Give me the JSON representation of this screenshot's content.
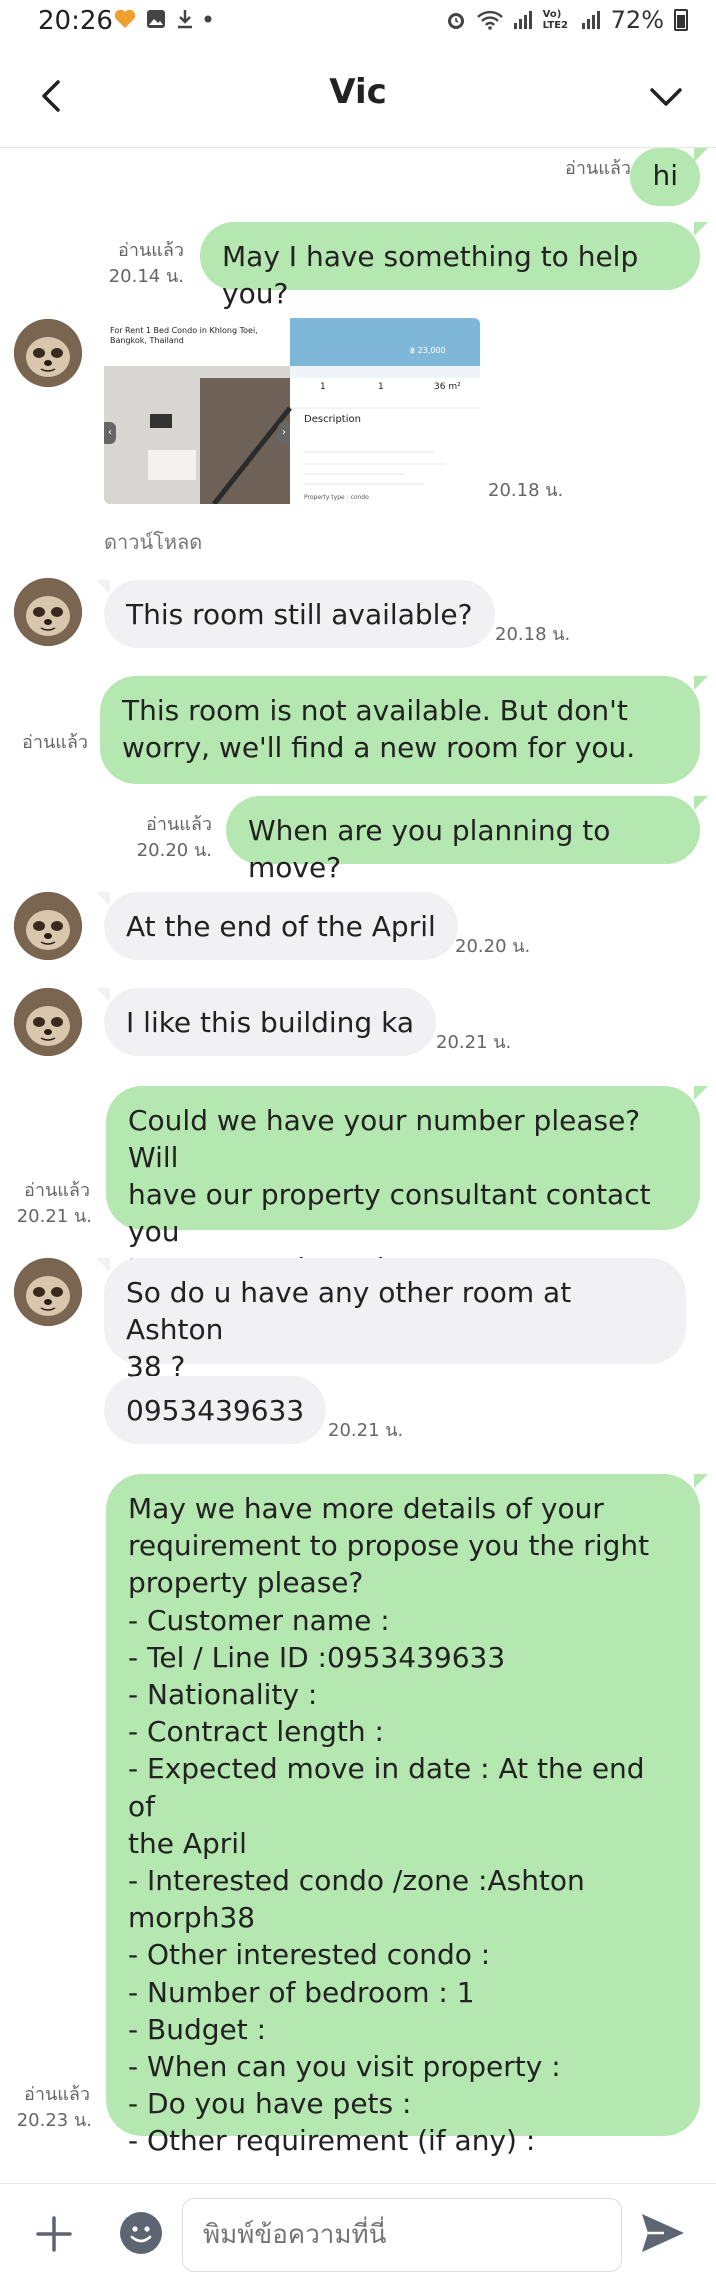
{
  "status_bar": {
    "time": "20:26",
    "carrier_label": "Vo) LTE2",
    "battery": "72%"
  },
  "header": {
    "title": "Vic"
  },
  "messages": {
    "m1": {
      "text": "hi",
      "receipt": "อ่านแล้ว"
    },
    "m2": {
      "text": "May I have something to help you?",
      "receipt": "อ่านแล้ว",
      "time": "20.14 น."
    },
    "m3": {
      "card_title": "For Rent 1 Bed Condo in Khlong Toei, Bangkok, Thailand",
      "card_price": "฿ 23,000",
      "card_beds": "1",
      "card_baths": "1",
      "card_area": "36 m²",
      "card_desc_heading": "Description",
      "card_prop_type": "Property type : condo",
      "time": "20.18 น.",
      "download": "ดาวน์โหลด"
    },
    "m4": {
      "text": "This room still available?",
      "time": "20.18 น."
    },
    "m5": {
      "text": "This room is not available.  But don't\nworry, we'll find a new room for you.",
      "receipt": "อ่านแล้ว"
    },
    "m6": {
      "text": "When are you planning to move?",
      "receipt": "อ่านแล้ว",
      "time": "20.20 น."
    },
    "m7": {
      "text": "At the end of the April",
      "time": "20.20 น."
    },
    "m8": {
      "text": "I like this building ka",
      "time": "20.21 น."
    },
    "m9": {
      "text": "Could we have your number please? Will\nhave our property consultant contact you\nto propose the units.",
      "receipt": "อ่านแล้ว",
      "time": "20.21 น."
    },
    "m10": {
      "text": "So do u have any other room at Ashton\n38 ?"
    },
    "m11": {
      "text": "0953439633",
      "time": "20.21 น."
    },
    "m12": {
      "text": "May we have more details of your\nrequirement to propose you the right\nproperty please?\n- Customer name :\n- Tel / Line ID :0953439633\n- Nationality :\n- Contract length :\n- Expected move in date : At the end of\nthe April\n- Interested condo /zone :Ashton\nmorph38\n- Other interested condo :\n- Number of bedroom  : 1\n- Budget :\n- When can you visit property :\n- Do you have pets :\n- Other requirement (if any) :",
      "receipt": "อ่านแล้ว",
      "time": "20.23 น."
    }
  },
  "input": {
    "placeholder": "พิมพ์ข้อความที่นี่"
  },
  "colors": {
    "outgoing_bubble": "#b5e8b0",
    "incoming_bubble": "#f1f1f3"
  }
}
